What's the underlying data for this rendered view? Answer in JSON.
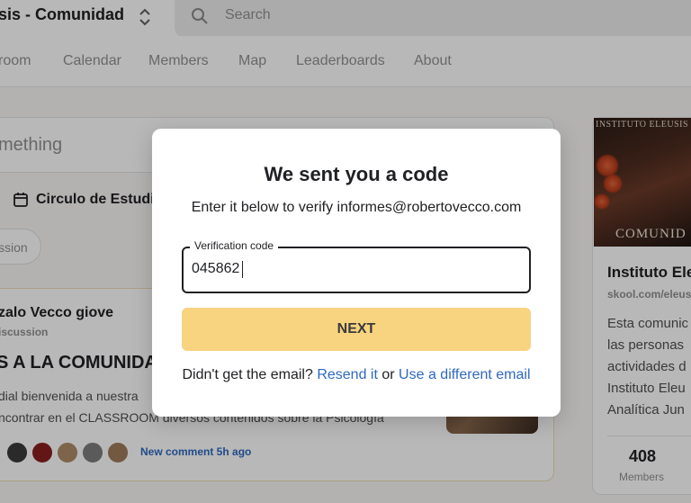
{
  "header": {
    "community_name": "sis - Comunidad",
    "search_placeholder": "Search"
  },
  "nav": {
    "items": [
      "room",
      "Calendar",
      "Members",
      "Map",
      "Leaderboards",
      "About"
    ]
  },
  "feed": {
    "composer_placeholder": "mething",
    "event_text": "Circulo de Estudio",
    "chip_label": "ssion",
    "post": {
      "author": "zalo Vecco giove",
      "category": "iscussion",
      "title": "S A LA COMUNIDAD",
      "body": "dial bienvenida a nuestra\nncontrar en el CLASSROOM diversos contenidos sobre la Psicología",
      "new_comment": "New comment 5h ago"
    }
  },
  "sidebar": {
    "cover_top": "INSTITUTO ELEUSIS",
    "cover_bottom": "COMUNID",
    "name": "Instituto Ele",
    "url": "skool.com/eleus",
    "description": "Esta comunic\nlas personas\nactividades d\nInstituto Eleu\nAnalítica Jun",
    "members_count": "408",
    "members_label": "Members"
  },
  "modal": {
    "title": "We sent you a code",
    "subtitle": "Enter it below to verify informes@robertovecco.com",
    "code_label": "Verification code",
    "code_value": "045862",
    "next_label": "NEXT",
    "resend_prefix": "Didn't get the email?",
    "resend_link": "Resend it",
    "or_text": "or",
    "different_email_link": "Use a different email"
  },
  "colors": {
    "accent_button": "#f8d481",
    "link": "#2f68c1"
  }
}
